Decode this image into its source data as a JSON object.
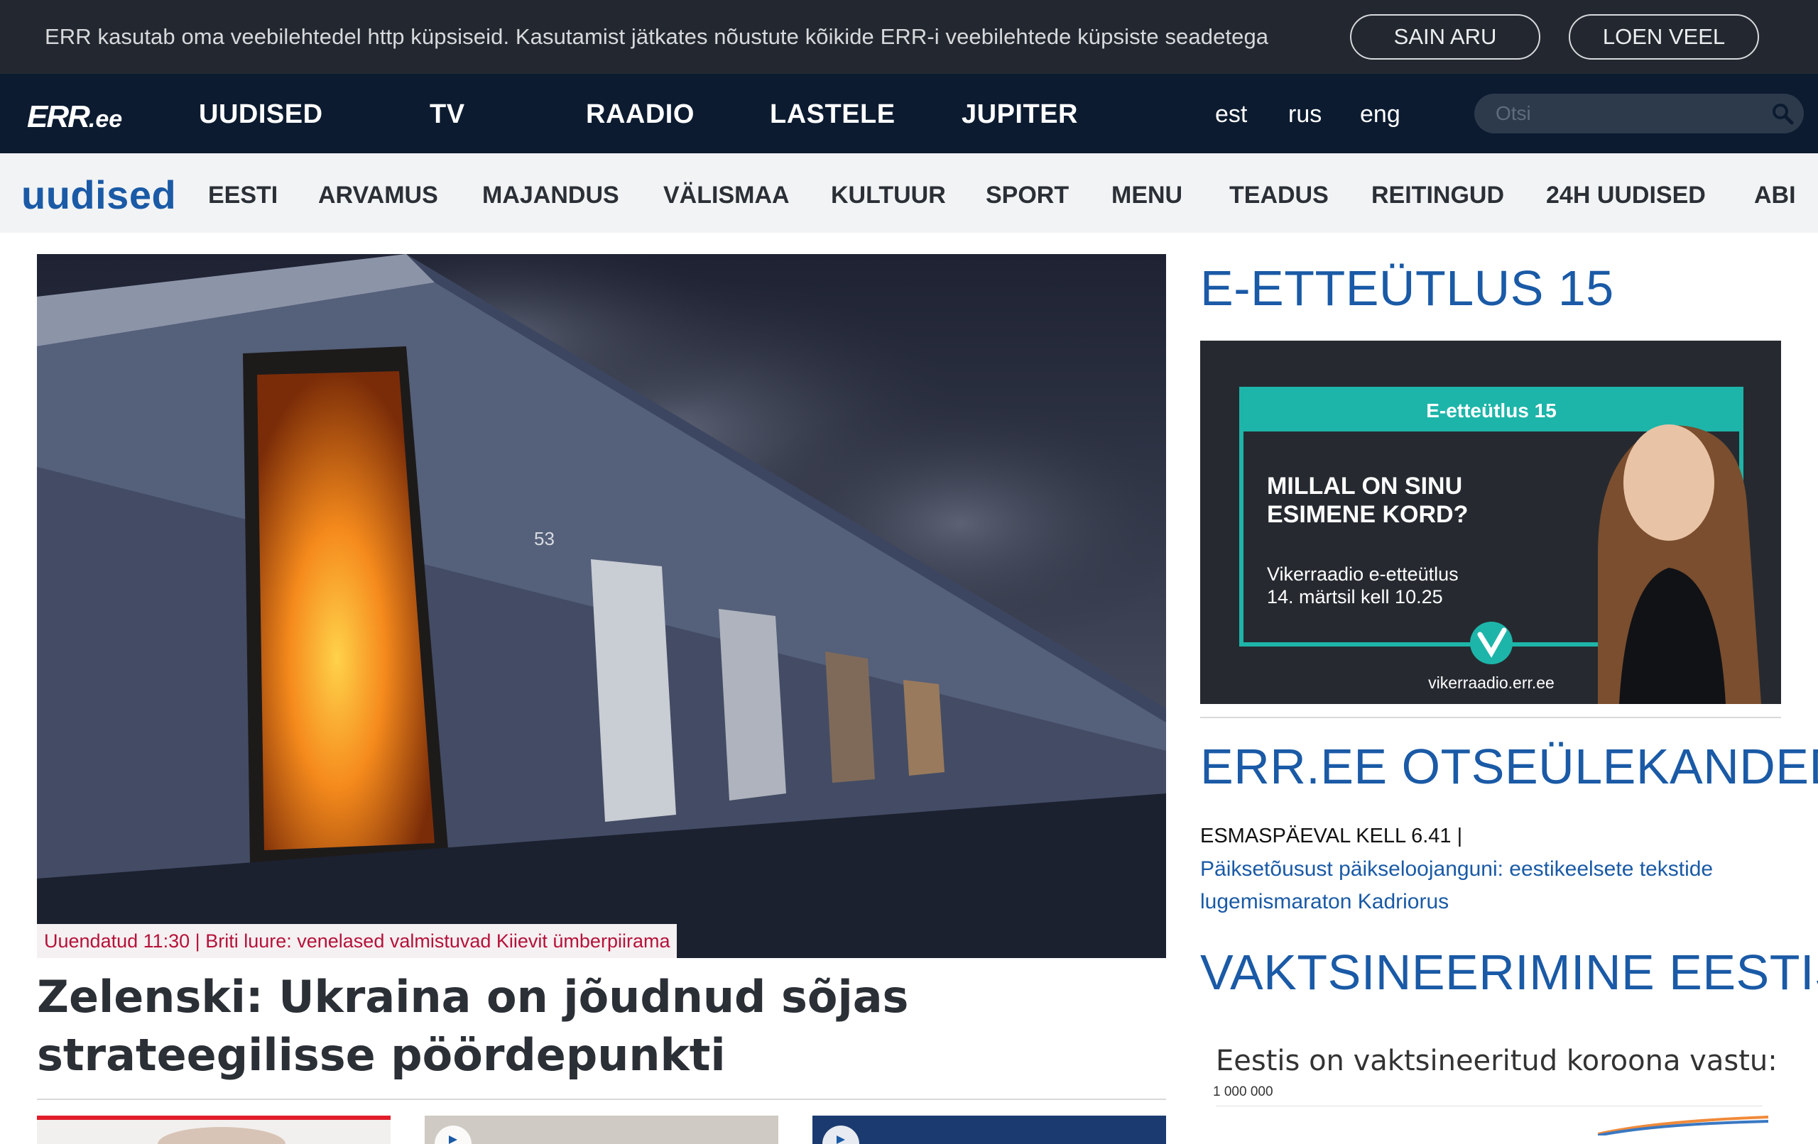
{
  "cookie": {
    "text": "ERR kasutab oma veebilehtedel http küpsiseid. Kasutamist jätkates nõustute kõikide ERR-i veebilehtede küpsiste seadetega",
    "accept": "SAIN ARU",
    "more": "LOEN VEEL"
  },
  "nav": {
    "logo": "ERR",
    "logo_suffix": ".ee",
    "items": [
      "UUDISED",
      "TV",
      "RAADIO",
      "LASTELE",
      "JUPITER"
    ],
    "langs": [
      "est",
      "rus",
      "eng"
    ],
    "search_placeholder": "Otsi"
  },
  "subnav": {
    "title": "uudised",
    "items": [
      "EESTI",
      "ARVAMUS",
      "MAJANDUS",
      "VÄLISMAA",
      "KULTUUR",
      "SPORT",
      "MENU",
      "TEADUS",
      "REITINGUD",
      "24H UUDISED",
      "ABI"
    ]
  },
  "hero": {
    "tag": "Uuendatud 11:30 | Briti luure: venelased valmistuvad Kiievit ümberpiirama",
    "headline": "Zelenski: Ukraina on jõudnud sõjas strateegilisse pöördepunkti",
    "door_number": "53"
  },
  "side": {
    "promo_title": "E-ETTEÜTLUS 15",
    "promo": {
      "label": "E-etteütlus 15",
      "headline_1": "MILLAL ON SINU",
      "headline_2": "ESIMENE KORD?",
      "line_1": "Vikerraadio e-etteütlus",
      "line_2": "14. märtsil kell 10.25",
      "url": "vikerraadio.err.ee"
    },
    "live_title": "ERR.EE OTSEÜLEKANDED",
    "live_time": "ESMASPÄEVAL KELL 6.41 |",
    "live_link": "Päiksetõusust päikseloojanguni: eestikeelsete tekstide lugemismaraton Kadriorus",
    "vacc_title": "VAKTSINEERIMINE EESTIS",
    "vacc_text": "Eestis on vaktsineeritud koroona vastu:",
    "vacc_axis": "1 000 000"
  },
  "colors": {
    "brand_blue": "#1a5aa6",
    "nav_bg": "#0c1b30",
    "cookie_bg": "#232830",
    "tag_red": "#b5123a",
    "promo_teal": "#1db5a9"
  }
}
